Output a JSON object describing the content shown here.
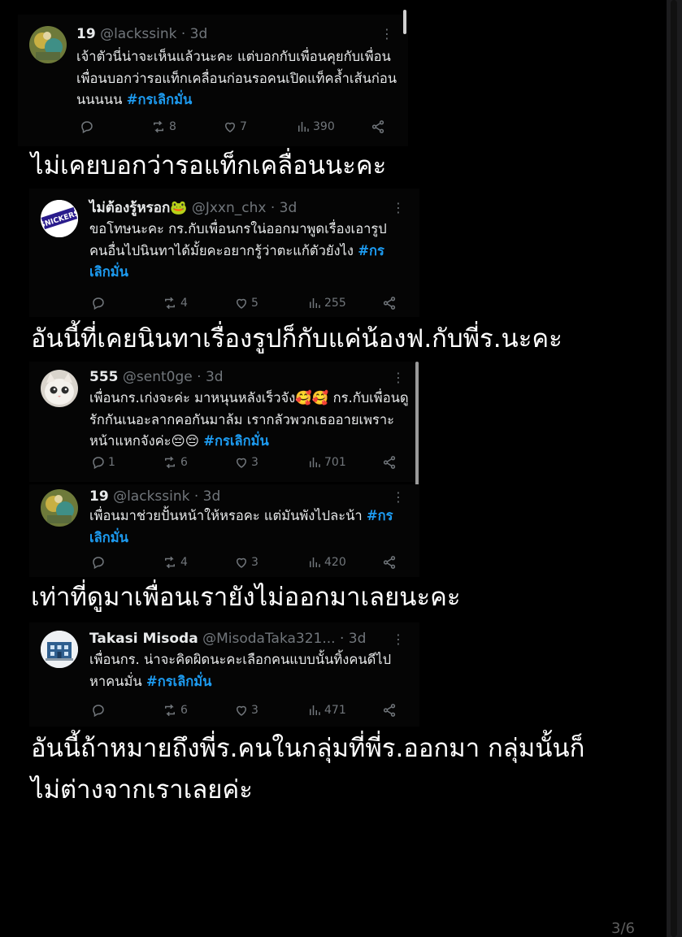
{
  "tweets": [
    {
      "name": "19",
      "handle": "@lackssink",
      "time": "· 3d",
      "text": "เจ้าตัวนี่น่าจะเห็นแล้วนะคะ แต่บอกกับเพื่อนคุยกับเพื่อน เพื่อนบอกว่ารอแท็กเคลื่อนก่อนรอคนเปิดแท็คล้ำเส้นก่อนนนนนน",
      "hashtag": "#กรเลิกมั่น",
      "replies": "",
      "retweets": "8",
      "likes": "7",
      "views": "390"
    },
    {
      "name": "ไม่ต้องรู้หรอก🐸",
      "handle": "@Jxxn_chx",
      "time": "· 3d",
      "text": "ขอโทษนะคะ กร.กับเพื่อนกรใน่ออกมาพูดเรื่องเอารูปคนอื่นไปนินทาได้มั้ยคะอยากรู้ว่าตะแก้ตัวยังไง",
      "hashtag": "#กรเลิกมั่น",
      "replies": "",
      "retweets": "4",
      "likes": "5",
      "views": "255"
    },
    {
      "name": "555",
      "handle": "@sent0ge",
      "time": "· 3d",
      "text": "เพื่อนกร.เก่งจะค่ะ มาหนุนหลังเร็วจัง🥰🥰 กร.กับเพื่อนดูรักกันเนอะลากคอกันมาล้ม เรากลัวพวกเธออายเพราะหน้าแหกจังค่ะ😔😔",
      "hashtag": "#กรเลิกมั่น",
      "replies": "1",
      "retweets": "6",
      "likes": "3",
      "views": "701"
    },
    {
      "name": "19",
      "handle": "@lackssink",
      "time": "· 3d",
      "text": "เพื่อนมาช่วยปั้นหน้าให้หรอคะ แต่มันพังไปละน้า",
      "hashtag": "#กรเลิกมั่น",
      "replies": "",
      "retweets": "4",
      "likes": "3",
      "views": "420"
    },
    {
      "name": "Takasi Misoda",
      "handle": "@MisodaTaka321...",
      "time": "· 3d",
      "text": "เพื่อนกร. น่าจะคิดผิดนะคะเลือกคนแบบนั้นทิ้งคนดีไปหาคนมั่น",
      "hashtag": "#กรเลิกมั่น",
      "replies": "",
      "retweets": "6",
      "likes": "3",
      "views": "471"
    }
  ],
  "captions": {
    "c1": "ไม่เคยบอกว่ารอแท็กเคลื่อนนะคะ",
    "c2": "อันนี้ที่เคยนินทาเรื่องรูปก็กับแค่น้องฟ.กับพี่ร.นะคะ",
    "c3": "เท่าที่ดูมาเพื่อนเรายังไม่ออกมาเลยนะคะ",
    "c4_line1": "อันนี้ถ้าหมายถึงพี่ร.คนในกลุ่มที่พี่ร.ออกมา กลุ่มนั้นก็",
    "c4_line2": "ไม่ต่างจากเราเลยค่ะ"
  },
  "avatar_badge_text": "SNICKERS",
  "page_indicator": "3/6",
  "colors": {
    "background": "#000000",
    "hashtag": "#1d9bf0",
    "muted": "#71767b",
    "text": "#e7e9ea"
  }
}
